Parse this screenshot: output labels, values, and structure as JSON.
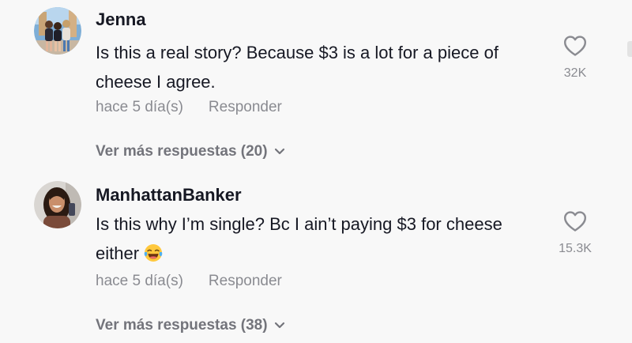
{
  "comments": [
    {
      "username": "Jenna",
      "avatar_icon": "avatar-three-people-photo",
      "text": "Is this a real story? Because $3 is a lot for a piece of cheese I agree.",
      "time": "hace 5 día(s)",
      "reply_label": "Responder",
      "more_replies": "Ver más respuestas (20)",
      "like_count": "32K",
      "like_icon": "heart-outline-icon"
    },
    {
      "username": "ManhattanBanker",
      "avatar_icon": "avatar-woman-photo",
      "text": "Is this why I’m single? Bc I ain’t paying $3 for cheese either",
      "emoji": "face-with-tears-of-joy-emoji",
      "time": "hace 5 día(s)",
      "reply_label": "Responder",
      "more_replies": "Ver más respuestas (38)",
      "like_count": "15.3K",
      "like_icon": "heart-outline-icon"
    }
  ],
  "colors": {
    "background": "#f8f8f8",
    "text_primary": "#161823",
    "text_secondary": "#8a8b91",
    "heart_stroke": "#8a8b91"
  }
}
